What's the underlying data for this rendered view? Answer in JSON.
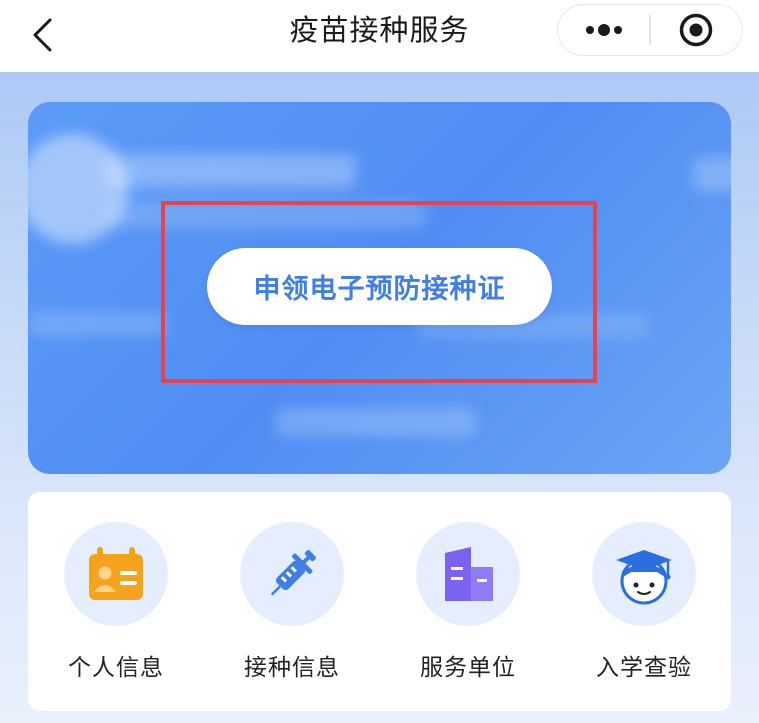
{
  "nav": {
    "title": "疫苗接种服务",
    "back_icon": "chevron-left-icon",
    "more_icon": "more-dots-icon",
    "close_icon": "target-close-icon"
  },
  "banner": {
    "apply_button_label": "申领电子预防接种证"
  },
  "services": [
    {
      "label": "个人信息",
      "icon": "id-card-icon",
      "color": "#f5a21c"
    },
    {
      "label": "接种信息",
      "icon": "syringe-icon",
      "color": "#3f7ee8"
    },
    {
      "label": "服务单位",
      "icon": "building-icon",
      "color": "#7b62ef"
    },
    {
      "label": "入学查验",
      "icon": "student-graduate-icon",
      "color": "#2a6fe0"
    }
  ],
  "colors": {
    "accent": "#3f7ee8",
    "banner": "#5193f5",
    "highlight": "#e8414f"
  }
}
